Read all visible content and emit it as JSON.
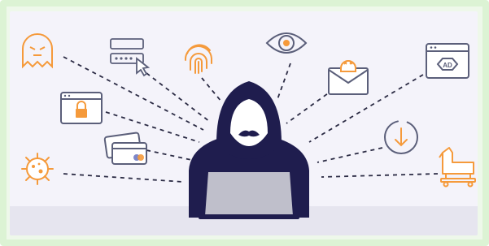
{
  "palette": {
    "background": "#f4f3fa",
    "floor": "#e6e5ef",
    "frame": "#dcf3d4",
    "navy": "#1f1d4e",
    "accent_orange": "#f59a3b",
    "slate": "#5b5f7a",
    "laptop": "#bfbfcb",
    "card_blue": "#7e87c9",
    "card_red": "#e5484d"
  },
  "icons": [
    "ghost-icon",
    "login-form-cursor-icon",
    "fingerprint-icon",
    "eye-icon",
    "envelope-skull-icon",
    "browser-ad-icon",
    "browser-lock-icon",
    "credit-cards-icon",
    "download-icon",
    "virus-icon",
    "trojan-horse-icon",
    "hooded-hacker-laptop"
  ],
  "ad_badge": {
    "text": "AD"
  }
}
